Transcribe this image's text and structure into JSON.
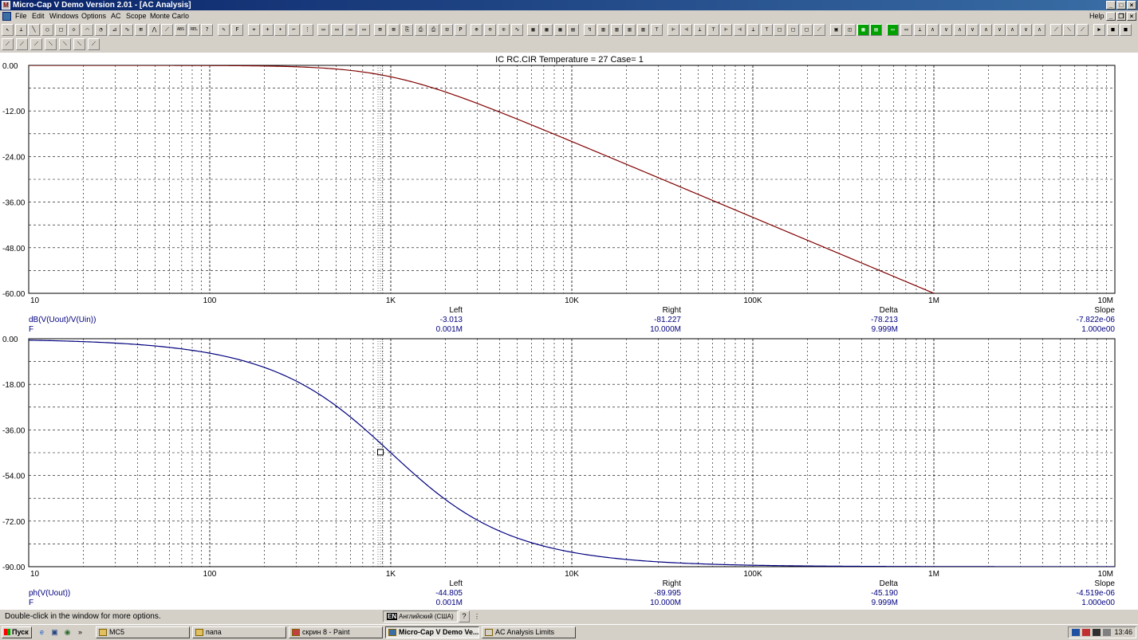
{
  "window": {
    "title": "Micro-Cap V Demo Version 2.01 - [AC Analysis]",
    "app_icon": "micro-cap-icon",
    "controls": [
      "minimize-icon",
      "maximize-icon",
      "close-icon"
    ]
  },
  "menu": {
    "items": [
      "File",
      "Edit",
      "Windows",
      "Options",
      "AC",
      "Scope",
      "Monte Carlo"
    ],
    "help": "Help"
  },
  "toolbar1": [
    {
      "icon": "select-arrow-icon",
      "glyph": "↖"
    },
    {
      "icon": "component-icon",
      "glyph": "⊥"
    },
    {
      "icon": "line-icon",
      "glyph": "╲"
    },
    {
      "icon": "ellipse-icon",
      "glyph": "○"
    },
    {
      "icon": "rectangle-icon",
      "glyph": "□"
    },
    {
      "icon": "diamond-icon",
      "glyph": "◇"
    },
    {
      "icon": "arc-icon",
      "glyph": "⌒"
    },
    {
      "icon": "pie-icon",
      "glyph": "◔"
    },
    {
      "icon": "graph-icon",
      "glyph": "⊿"
    },
    {
      "icon": "wave-icon",
      "glyph": "∿"
    },
    {
      "icon": "scale-icon",
      "glyph": "⊞"
    },
    {
      "icon": "peak-icon",
      "glyph": "⋀"
    },
    {
      "icon": "slope-icon",
      "glyph": "⟋"
    },
    {
      "icon": "abs-icon",
      "glyph": "ABS"
    },
    {
      "icon": "rel-icon",
      "glyph": "REL"
    },
    {
      "icon": "help-icon",
      "glyph": "?"
    },
    {
      "icon": "pen-icon",
      "glyph": "✎"
    },
    {
      "icon": "font-icon",
      "glyph": "F"
    },
    {
      "icon": "cursor-icon",
      "glyph": "⌖"
    },
    {
      "icon": "cross-icon",
      "glyph": "+"
    },
    {
      "icon": "point-icon",
      "glyph": "∙"
    },
    {
      "icon": "tag-icon",
      "glyph": "⌐"
    },
    {
      "icon": "grid-icon",
      "glyph": "⋮"
    },
    {
      "icon": "window1-icon",
      "glyph": "▭"
    },
    {
      "icon": "window2-icon",
      "glyph": "▭"
    },
    {
      "icon": "window3-icon",
      "glyph": "▭"
    },
    {
      "icon": "window4-icon",
      "glyph": "▭"
    },
    {
      "icon": "tile-icon",
      "glyph": "⊞"
    },
    {
      "icon": "xclose-icon",
      "glyph": "⊠"
    },
    {
      "icon": "copy-icon",
      "glyph": "⎘"
    },
    {
      "icon": "print-icon",
      "glyph": "⎙"
    },
    {
      "icon": "print2-icon",
      "glyph": "⎙"
    },
    {
      "icon": "paste-icon",
      "glyph": "⊡"
    },
    {
      "icon": "properties-icon",
      "glyph": "P"
    },
    {
      "icon": "zoom-in-icon",
      "glyph": "⊕"
    },
    {
      "icon": "zoom-out-icon",
      "glyph": "⊖"
    },
    {
      "icon": "zoom-fit-icon",
      "glyph": "⊙"
    },
    {
      "icon": "waveform-icon",
      "glyph": "∿"
    },
    {
      "icon": "table-icon",
      "glyph": "▦"
    },
    {
      "icon": "table2-icon",
      "glyph": "▦"
    },
    {
      "icon": "table3-icon",
      "glyph": "▦"
    },
    {
      "icon": "numbers-icon",
      "glyph": "▤"
    },
    {
      "icon": "run-icon",
      "glyph": "↯"
    },
    {
      "icon": "bars1-icon",
      "glyph": "▥"
    },
    {
      "icon": "bars2-icon",
      "glyph": "▥"
    },
    {
      "icon": "bars3-icon",
      "glyph": "▥"
    },
    {
      "icon": "bars4-icon",
      "glyph": "▥"
    },
    {
      "icon": "a-icon",
      "glyph": "⊤"
    },
    {
      "icon": "b-icon",
      "glyph": "⊢"
    },
    {
      "icon": "c-icon",
      "glyph": "⊣"
    },
    {
      "icon": "d-icon",
      "glyph": "⊥"
    },
    {
      "icon": "e-icon",
      "glyph": "⊤"
    },
    {
      "icon": "f-icon",
      "glyph": "⊢"
    },
    {
      "icon": "g-icon",
      "glyph": "⊣"
    },
    {
      "icon": "h-icon",
      "glyph": "⊥"
    },
    {
      "icon": "i-icon",
      "glyph": "⊤"
    },
    {
      "icon": "j-icon",
      "glyph": "□"
    },
    {
      "icon": "k-icon",
      "glyph": "□"
    },
    {
      "icon": "l-icon",
      "glyph": "□"
    },
    {
      "icon": "m-icon",
      "glyph": "⟋"
    },
    {
      "icon": "n-icon",
      "glyph": "▣"
    },
    {
      "icon": "o-icon",
      "glyph": "◫"
    },
    {
      "icon": "grid-on-icon",
      "glyph": "▦",
      "active": true
    },
    {
      "icon": "grid-minor-icon",
      "glyph": "▤",
      "active": true
    },
    {
      "icon": "grid-off-icon",
      "glyph": "▭",
      "active": true
    },
    {
      "icon": "p-icon",
      "glyph": "▭"
    },
    {
      "icon": "q-icon",
      "glyph": "⊥"
    },
    {
      "icon": "r-icon",
      "glyph": "∧"
    },
    {
      "icon": "s-icon",
      "glyph": "∨"
    },
    {
      "icon": "t-icon",
      "glyph": "∧"
    },
    {
      "icon": "u-icon",
      "glyph": "∨"
    },
    {
      "icon": "v-icon",
      "glyph": "∧"
    },
    {
      "icon": "w-icon",
      "glyph": "∨"
    },
    {
      "icon": "x-icon",
      "glyph": "∧"
    },
    {
      "icon": "y-icon",
      "glyph": "∨"
    },
    {
      "icon": "z-icon",
      "glyph": "∧"
    },
    {
      "icon": "aa-icon",
      "glyph": "⟋"
    },
    {
      "icon": "bb-icon",
      "glyph": "⟍"
    },
    {
      "icon": "cc-icon",
      "glyph": "⟋"
    },
    {
      "icon": "play-icon",
      "glyph": "▶"
    },
    {
      "icon": "stop-icon",
      "glyph": "■"
    },
    {
      "icon": "stop2-icon",
      "glyph": "■"
    }
  ],
  "toolbar2": [
    {
      "icon": "tool1-icon",
      "glyph": "⟋"
    },
    {
      "icon": "tool2-icon",
      "glyph": "⟋"
    },
    {
      "icon": "tool3-icon",
      "glyph": "⟋"
    },
    {
      "icon": "tool4-icon",
      "glyph": "⟍"
    },
    {
      "icon": "tool5-icon",
      "glyph": "⟍"
    },
    {
      "icon": "tool6-icon",
      "glyph": "⟍"
    },
    {
      "icon": "tool7-icon",
      "glyph": "⟋"
    }
  ],
  "plot": {
    "title": "IC  RC.CIR Temperature = 27 Case= 1",
    "trace_color_top": "#800000",
    "trace_color_bottom": "#00007f",
    "label_color": "#00007f"
  },
  "chart_data": [
    {
      "type": "line",
      "x_scale": "log",
      "xlim": [
        10,
        10000000
      ],
      "x_ticks": [
        "10",
        "100",
        "1K",
        "10K",
        "100K",
        "1M",
        "10M"
      ],
      "ylim": [
        -60,
        0
      ],
      "y_ticks": [
        "0.00",
        "-12.00",
        "-24.00",
        "-36.00",
        "-48.00",
        "-60.00"
      ],
      "grid": "on",
      "series": [
        {
          "name": "dB(V(Uout)/V(Uin))",
          "fc_hz": 1000,
          "kind": "magnitude_db",
          "x": [
            10,
            100,
            200,
            500,
            1000,
            2000,
            5000,
            10000,
            50000,
            100000,
            500000,
            900000
          ],
          "y": [
            0.0,
            -0.04,
            -0.17,
            -0.97,
            -3.01,
            -6.99,
            -14.15,
            -20.04,
            -33.98,
            -40.0,
            -53.98,
            -59.09
          ]
        }
      ],
      "cursor_readout": {
        "headers": [
          "Left",
          "Right",
          "Delta",
          "Slope"
        ],
        "row1_label": "dB(V(Uout)/V(Uin))",
        "row1": [
          "-3.013",
          "-81.227",
          "-78.213",
          "-7.822e-06"
        ],
        "row2_label": "F",
        "row2": [
          "0.001M",
          "10.000M",
          "9.999M",
          "1.000e00"
        ]
      }
    },
    {
      "type": "line",
      "x_scale": "log",
      "xlim": [
        10,
        10000000
      ],
      "x_ticks": [
        "10",
        "100",
        "1K",
        "10K",
        "100K",
        "1M",
        "10M"
      ],
      "ylim": [
        -90,
        0
      ],
      "y_ticks": [
        "0.00",
        "-18.00",
        "-36.00",
        "-54.00",
        "-72.00",
        "-90.00"
      ],
      "grid": "on",
      "series": [
        {
          "name": "ph(V(Uout))",
          "fc_hz": 1000,
          "kind": "phase_deg",
          "x": [
            10,
            100,
            300,
            1000,
            3000,
            10000,
            100000,
            1000000,
            10000000
          ],
          "y": [
            -0.57,
            -5.71,
            -16.7,
            -45.0,
            -71.57,
            -84.29,
            -89.43,
            -89.94,
            -89.99
          ]
        }
      ],
      "cursor_marker": {
        "x": 1000,
        "y": -44.805
      },
      "cursor_readout": {
        "headers": [
          "Left",
          "Right",
          "Delta",
          "Slope"
        ],
        "row1_label": "ph(V(Uout))",
        "row1": [
          "-44.805",
          "-89.995",
          "-45.190",
          "-4.519e-06"
        ],
        "row2_label": "F",
        "row2": [
          "0.001M",
          "10.000M",
          "9.999M",
          "1.000e00"
        ]
      }
    }
  ],
  "status": {
    "message": "Double-click in the window for more options.",
    "lang_code": "EN",
    "lang": "Английский (США)",
    "help": "?"
  },
  "taskbar": {
    "start": "Пуск",
    "quicklaunch": [
      "ie-icon",
      "desktop-icon",
      "media-icon"
    ],
    "chevron": "»",
    "tasks": [
      {
        "label": "MC5",
        "icon": "folder-icon",
        "active": false
      },
      {
        "label": "папа",
        "icon": "folder-icon",
        "active": false
      },
      {
        "label": "скрин 8 - Paint",
        "icon": "paint-icon",
        "active": false
      },
      {
        "label": "Micro-Cap V Demo Ve...",
        "icon": "microcap-icon",
        "active": true
      },
      {
        "label": "AC Analysis Limits",
        "icon": "dialog-icon",
        "active": false
      }
    ],
    "tray_icons": [
      "network-icon",
      "volume-icon",
      "antivirus-icon",
      "tray-icon"
    ],
    "clock": "13:46"
  }
}
